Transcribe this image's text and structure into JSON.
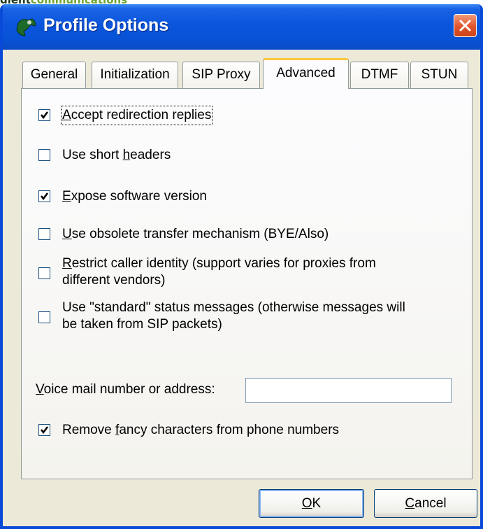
{
  "brand": {
    "part1": "dient",
    "part2": "communications"
  },
  "window": {
    "title": "Profile Options"
  },
  "tabs": [
    {
      "label": "General"
    },
    {
      "label": "Initialization"
    },
    {
      "label": "SIP Proxy"
    },
    {
      "label": "Advanced",
      "active": true
    },
    {
      "label": "DTMF"
    },
    {
      "label": "STUN"
    }
  ],
  "advanced": {
    "options": [
      {
        "label_pre": "",
        "label_key": "A",
        "label_post": "ccept redirection replies",
        "checked": true
      },
      {
        "label_pre": "Use short ",
        "label_key": "h",
        "label_post": "eaders",
        "checked": false
      },
      {
        "label_pre": "",
        "label_key": "E",
        "label_post": "xpose software version",
        "checked": true
      },
      {
        "label_pre": "",
        "label_key": "U",
        "label_post": "se obsolete transfer mechanism (BYE/Also)",
        "checked": false
      },
      {
        "label_pre": "",
        "label_key": "R",
        "label_post": "estrict caller identity (support varies for proxies from",
        "line2": "different vendors)",
        "checked": false
      },
      {
        "label_pre": "Use \"standard\" status messages (otherwise messages will",
        "label_key": "",
        "label_post": "",
        "line2": "be taken from SIP packets)",
        "checked": false
      }
    ],
    "voice_mail": {
      "label_key": "V",
      "label_rest": "oice mail number or address:",
      "value": ""
    },
    "remove_fancy": {
      "label_pre": "Remove ",
      "label_key": "f",
      "label_post": "ancy characters from phone numbers",
      "checked": true
    }
  },
  "buttons": {
    "ok": {
      "label_key": "O",
      "label_rest": "K"
    },
    "cancel": {
      "label_key": "C",
      "label_rest": "ancel"
    }
  }
}
